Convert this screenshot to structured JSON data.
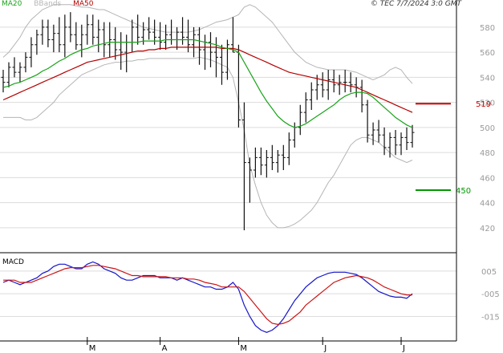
{
  "legend": {
    "ma20": {
      "label": "MA20",
      "color": "#19a319"
    },
    "bbands": {
      "label": "BBands",
      "color": "#b5b5b5"
    },
    "ma50": {
      "label": "MA50",
      "color": "#b40000"
    }
  },
  "timestamp": "© TEC 7/7/2024 3:0 GMT",
  "macd_title": "MACD",
  "chart_data": [
    {
      "type": "candlestick",
      "title": "",
      "y_ticks": [
        420,
        440,
        460,
        480,
        500,
        520,
        540,
        560,
        580
      ],
      "ylim": [
        402,
        594
      ],
      "x_tick_labels": [
        "M",
        "A",
        "M",
        "J",
        "J"
      ],
      "x_tick_index": [
        15,
        28,
        42,
        57,
        71
      ],
      "n_bars": 74,
      "grid": true,
      "ohlc": [
        [
          540,
          546,
          528,
          536
        ],
        [
          536,
          552,
          532,
          548
        ],
        [
          548,
          556,
          540,
          544
        ],
        [
          544,
          552,
          536,
          548
        ],
        [
          548,
          560,
          544,
          556
        ],
        [
          556,
          572,
          548,
          566
        ],
        [
          566,
          578,
          558,
          574
        ],
        [
          574,
          586,
          566,
          580
        ],
        [
          580,
          586,
          564,
          570
        ],
        [
          570,
          582,
          560,
          575
        ],
        [
          575,
          588,
          560,
          566
        ],
        [
          566,
          590,
          556,
          580
        ],
        [
          580,
          592,
          568,
          574
        ],
        [
          574,
          584,
          562,
          566
        ],
        [
          566,
          582,
          556,
          574
        ],
        [
          574,
          590,
          566,
          582
        ],
        [
          582,
          590,
          566,
          572
        ],
        [
          572,
          586,
          560,
          578
        ],
        [
          578,
          584,
          556,
          566
        ],
        [
          566,
          584,
          556,
          570
        ],
        [
          570,
          580,
          554,
          562
        ],
        [
          562,
          576,
          546,
          560
        ],
        [
          560,
          574,
          544,
          568
        ],
        [
          568,
          586,
          560,
          580
        ],
        [
          580,
          590,
          566,
          572
        ],
        [
          572,
          584,
          566,
          578
        ],
        [
          578,
          588,
          570,
          576
        ],
        [
          576,
          586,
          566,
          572
        ],
        [
          572,
          584,
          562,
          568
        ],
        [
          568,
          582,
          562,
          574
        ],
        [
          574,
          586,
          566,
          570
        ],
        [
          570,
          580,
          562,
          576
        ],
        [
          576,
          588,
          566,
          572
        ],
        [
          572,
          586,
          560,
          566
        ],
        [
          566,
          580,
          556,
          574
        ],
        [
          574,
          580,
          550,
          562
        ],
        [
          562,
          574,
          546,
          568
        ],
        [
          568,
          576,
          548,
          560
        ],
        [
          560,
          572,
          540,
          556
        ],
        [
          556,
          566,
          534,
          544
        ],
        [
          544,
          570,
          538,
          566
        ],
        [
          566,
          588,
          560,
          560
        ],
        [
          560,
          566,
          500,
          506
        ],
        [
          506,
          520,
          418,
          472
        ],
        [
          472,
          476,
          440,
          466
        ],
        [
          466,
          484,
          460,
          476
        ],
        [
          476,
          484,
          462,
          470
        ],
        [
          470,
          482,
          460,
          476
        ],
        [
          476,
          486,
          466,
          472
        ],
        [
          472,
          482,
          464,
          478
        ],
        [
          478,
          486,
          466,
          476
        ],
        [
          476,
          496,
          470,
          490
        ],
        [
          490,
          504,
          484,
          500
        ],
        [
          500,
          518,
          494,
          512
        ],
        [
          512,
          528,
          504,
          522
        ],
        [
          522,
          536,
          514,
          530
        ],
        [
          530,
          542,
          522,
          534
        ],
        [
          534,
          544,
          524,
          530
        ],
        [
          530,
          546,
          522,
          538
        ],
        [
          538,
          546,
          528,
          534
        ],
        [
          534,
          542,
          526,
          536
        ],
        [
          536,
          546,
          528,
          536
        ],
        [
          536,
          544,
          528,
          534
        ],
        [
          534,
          540,
          524,
          532
        ],
        [
          532,
          538,
          512,
          518
        ],
        [
          518,
          522,
          488,
          494
        ],
        [
          494,
          504,
          486,
          498
        ],
        [
          498,
          506,
          488,
          494
        ],
        [
          494,
          500,
          478,
          484
        ],
        [
          484,
          496,
          476,
          492
        ],
        [
          492,
          498,
          478,
          486
        ],
        [
          486,
          496,
          478,
          492
        ],
        [
          492,
          500,
          482,
          488
        ],
        [
          488,
          502,
          484,
          496
        ]
      ],
      "ma20": [
        532,
        533,
        535,
        536,
        538,
        540,
        542,
        545,
        547,
        550,
        553,
        555,
        558,
        560,
        562,
        563,
        565,
        566,
        567,
        568,
        568,
        568,
        568,
        568,
        568,
        569,
        569,
        569,
        569,
        570,
        570,
        570,
        570,
        570,
        570,
        569,
        568,
        567,
        566,
        564,
        563,
        562,
        560,
        552,
        544,
        536,
        528,
        521,
        515,
        509,
        505,
        502,
        500,
        501,
        503,
        506,
        509,
        512,
        515,
        518,
        522,
        525,
        527,
        528,
        528,
        527,
        524,
        520,
        516,
        512,
        508,
        505,
        502,
        500
      ],
      "ma50": [
        522,
        524,
        526,
        528,
        530,
        532,
        534,
        536,
        538,
        540,
        542,
        544,
        546,
        548,
        550,
        552,
        553,
        554,
        555,
        556,
        557,
        558,
        559,
        560,
        561,
        561,
        562,
        562,
        563,
        563,
        564,
        564,
        564,
        564,
        564,
        564,
        564,
        564,
        564,
        563,
        563,
        563,
        562,
        560,
        558,
        556,
        554,
        552,
        550,
        548,
        546,
        544,
        543,
        542,
        541,
        540,
        539,
        538,
        537,
        536,
        535,
        534,
        533,
        532,
        530,
        528,
        526,
        524,
        522,
        520,
        518,
        516,
        514,
        512
      ],
      "bb_upper": [
        556,
        560,
        566,
        572,
        580,
        586,
        590,
        594,
        596,
        598,
        598,
        598,
        598,
        597,
        596,
        596,
        595,
        594,
        594,
        592,
        590,
        588,
        586,
        584,
        582,
        580,
        579,
        578,
        577,
        576,
        576,
        576,
        576,
        576,
        577,
        578,
        580,
        582,
        584,
        585,
        586,
        588,
        590,
        596,
        598,
        596,
        592,
        588,
        584,
        578,
        572,
        566,
        560,
        556,
        552,
        550,
        548,
        547,
        546,
        546,
        546,
        546,
        545,
        544,
        542,
        540,
        538,
        540,
        542,
        546,
        548,
        546,
        540,
        535
      ],
      "bb_lower": [
        508,
        508,
        508,
        508,
        506,
        506,
        508,
        512,
        516,
        520,
        526,
        530,
        534,
        538,
        542,
        544,
        546,
        548,
        550,
        551,
        552,
        552,
        553,
        553,
        554,
        554,
        555,
        555,
        555,
        555,
        555,
        555,
        555,
        555,
        555,
        556,
        555,
        554,
        552,
        550,
        548,
        540,
        520,
        498,
        470,
        454,
        440,
        430,
        424,
        420,
        420,
        421,
        423,
        426,
        430,
        434,
        440,
        448,
        456,
        462,
        470,
        478,
        486,
        490,
        492,
        492,
        490,
        488,
        484,
        480,
        476,
        474,
        472,
        474
      ]
    },
    {
      "type": "line",
      "title": "MACD",
      "y_ticks": [
        0.05,
        -0.05,
        -0.15
      ],
      "y_tick_labels": [
        "005",
        "-005",
        "-015"
      ],
      "ylim": [
        -0.24,
        0.12
      ],
      "series": [
        {
          "values": [
            0.0,
            0.01,
            0.0,
            -0.01,
            0.0,
            0.01,
            0.02,
            0.04,
            0.05,
            0.07,
            0.08,
            0.08,
            0.07,
            0.06,
            0.06,
            0.08,
            0.09,
            0.08,
            0.06,
            0.05,
            0.04,
            0.02,
            0.01,
            0.01,
            0.02,
            0.03,
            0.03,
            0.03,
            0.02,
            0.02,
            0.02,
            0.01,
            0.02,
            0.01,
            0.0,
            -0.01,
            -0.02,
            -0.02,
            -0.03,
            -0.03,
            -0.02,
            0.0,
            -0.03,
            -0.1,
            -0.15,
            -0.19,
            -0.21,
            -0.22,
            -0.21,
            -0.19,
            -0.16,
            -0.12,
            -0.08,
            -0.05,
            -0.02,
            0.0,
            0.02,
            0.03,
            0.04,
            0.045,
            0.045,
            0.045,
            0.04,
            0.035,
            0.02,
            0.0,
            -0.02,
            -0.04,
            -0.05,
            -0.06,
            -0.065,
            -0.065,
            -0.07,
            -0.05
          ],
          "color": "#1515cc"
        },
        {
          "values": [
            0.01,
            0.01,
            0.01,
            0.0,
            0.0,
            0.0,
            0.01,
            0.02,
            0.03,
            0.04,
            0.05,
            0.06,
            0.065,
            0.065,
            0.065,
            0.07,
            0.075,
            0.075,
            0.07,
            0.065,
            0.06,
            0.05,
            0.04,
            0.03,
            0.03,
            0.025,
            0.025,
            0.025,
            0.025,
            0.025,
            0.02,
            0.02,
            0.02,
            0.015,
            0.015,
            0.01,
            0.0,
            -0.005,
            -0.01,
            -0.02,
            -0.02,
            -0.02,
            -0.02,
            -0.04,
            -0.07,
            -0.1,
            -0.13,
            -0.16,
            -0.18,
            -0.185,
            -0.18,
            -0.17,
            -0.15,
            -0.13,
            -0.1,
            -0.08,
            -0.06,
            -0.04,
            -0.02,
            0.0,
            0.01,
            0.02,
            0.025,
            0.03,
            0.025,
            0.02,
            0.01,
            -0.005,
            -0.02,
            -0.03,
            -0.04,
            -0.05,
            -0.055,
            -0.055
          ],
          "color": "#cc1515"
        }
      ]
    }
  ],
  "levels": [
    {
      "label": "519",
      "value": 519,
      "color": "#cc0000"
    },
    {
      "label": "450",
      "value": 450,
      "color": "#009900"
    }
  ]
}
